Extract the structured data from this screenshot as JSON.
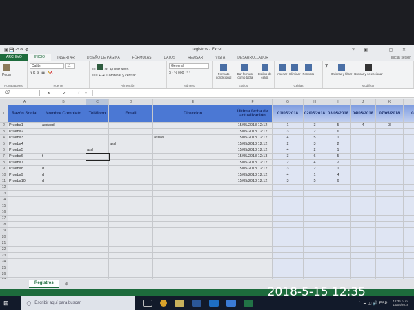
{
  "window": {
    "title": "registros - Excel",
    "controls": "? ▣ – ▢ ✕"
  },
  "tabs": [
    "ARCHIVO",
    "INICIO",
    "INSERTAR",
    "DISEÑO DE PÁGINA",
    "FÓRMULAS",
    "DATOS",
    "REVISAR",
    "VISTA",
    "DESARROLLADOR"
  ],
  "user": "Iniciar sesión",
  "ribbon": {
    "paste": "Pegar",
    "clipboard": "Portapapeles",
    "font": "Calibri",
    "size": "11",
    "font_group": "Fuente",
    "wrap": "Ajustar texto",
    "merge": "Combinar y centrar",
    "align_group": "Alineación",
    "number_format": "General",
    "number_group": "Número",
    "cond": "Formato condicional",
    "table": "Dar formato como tabla",
    "styles": "Estilos de celda",
    "styles_group": "Estilos",
    "insert": "Insertar",
    "delete": "Eliminar",
    "format": "Formato",
    "cells_group": "Celdas",
    "sort": "Ordenar y filtrar",
    "find": "Buscar y seleccionar",
    "edit_group": "Modificar"
  },
  "formula_bar": {
    "name_box": "C7",
    "fx": "✕ ✓ fx",
    "value": ""
  },
  "columns": [
    "A",
    "B",
    "C",
    "D",
    "E",
    "F",
    "G",
    "H",
    "I",
    "J",
    "K",
    "L"
  ],
  "headers": [
    "Razón Social",
    "Nombre Completo",
    "Teléfono",
    "Email",
    "Direccion",
    "Última fecha de actualización",
    "01/05/2018",
    "02/05/2018",
    "03/05/2018",
    "04/05/2018",
    "07/05/2018",
    "08/0"
  ],
  "rows": [
    [
      "Prueba1",
      "asdasd",
      "",
      "",
      "",
      "15/05/2018 12:12",
      "1",
      "3",
      "5",
      "4",
      "3",
      ""
    ],
    [
      "Prueba2",
      "",
      "",
      "",
      "",
      "15/05/2018 12:12",
      "3",
      "2",
      "6",
      "",
      "",
      ""
    ],
    [
      "Prueba3",
      "",
      "",
      "",
      "asdas",
      "15/05/2018 12:12",
      "4",
      "5",
      "1",
      "",
      "",
      ""
    ],
    [
      "Prueba4",
      "",
      "",
      "asd",
      "",
      "15/05/2018 12:12",
      "2",
      "3",
      "2",
      "",
      "",
      ""
    ],
    [
      "Prueba5",
      "",
      "asd",
      "",
      "",
      "15/05/2018 12:12",
      "4",
      "2",
      "1",
      "",
      "",
      ""
    ],
    [
      "Prueba6",
      "f",
      "",
      "",
      "",
      "15/05/2018 12:13",
      "3",
      "6",
      "5",
      "",
      "",
      ""
    ],
    [
      "Prueba7",
      "",
      "",
      "",
      "",
      "15/05/2018 12:12",
      "2",
      "4",
      "2",
      "",
      "",
      ""
    ],
    [
      "Prueba8",
      "d",
      "",
      "",
      "",
      "15/05/2018 12:12",
      "3",
      "2",
      "1",
      "",
      "",
      ""
    ],
    [
      "Prueba9",
      "d",
      "",
      "",
      "",
      "15/05/2018 12:12",
      "4",
      "1",
      "4",
      "",
      "",
      ""
    ],
    [
      "Prueba10",
      "d",
      "",
      "",
      "",
      "15/05/2018 12:12",
      "3",
      "5",
      "6",
      "",
      "",
      ""
    ]
  ],
  "sheet_tab": "Registros",
  "add_sheet": "⊕",
  "taskbar": {
    "search": "Escribir aquí para buscar",
    "time": "12:35 p. m.",
    "date": "15/05/2018",
    "lang": "ESP"
  },
  "photo_stamp": "2018-5-15  12:35"
}
